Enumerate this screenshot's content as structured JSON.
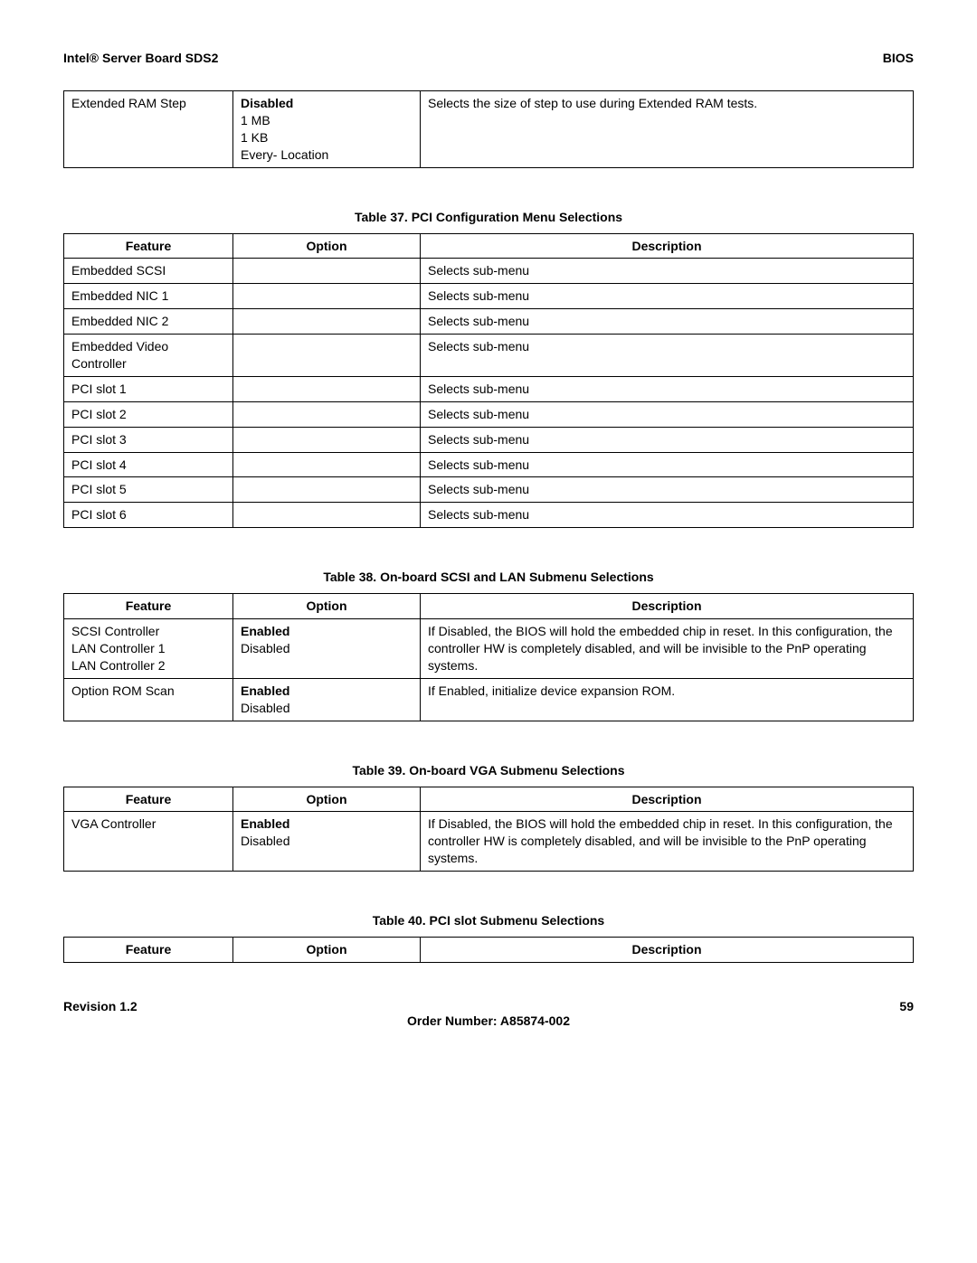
{
  "header": {
    "left": "Intel® Server Board SDS2",
    "right": "BIOS"
  },
  "table36": {
    "rows": [
      {
        "feature": "Extended RAM Step",
        "options": [
          "Disabled",
          "1 MB",
          "1 KB",
          "Every- Location"
        ],
        "default_index": 0,
        "description": "Selects the size of step to use during Extended RAM tests."
      }
    ]
  },
  "table37": {
    "caption": "Table 37. PCI Configuration Menu Selections",
    "headers": {
      "feature": "Feature",
      "option": "Option",
      "description": "Description"
    },
    "rows": [
      {
        "feature": "Embedded SCSI",
        "option": "",
        "description": "Selects sub-menu"
      },
      {
        "feature": "Embedded NIC 1",
        "option": "",
        "description": "Selects sub-menu"
      },
      {
        "feature": "Embedded NIC 2",
        "option": "",
        "description": "Selects sub-menu"
      },
      {
        "feature": "Embedded Video Controller",
        "option": "",
        "description": "Selects sub-menu"
      },
      {
        "feature": "PCI slot 1",
        "option": "",
        "description": "Selects sub-menu"
      },
      {
        "feature": "PCI slot 2",
        "option": "",
        "description": "Selects sub-menu"
      },
      {
        "feature": "PCI slot 3",
        "option": "",
        "description": "Selects sub-menu"
      },
      {
        "feature": "PCI slot 4",
        "option": "",
        "description": "Selects sub-menu"
      },
      {
        "feature": "PCI slot 5",
        "option": "",
        "description": "Selects sub-menu"
      },
      {
        "feature": "PCI slot 6",
        "option": "",
        "description": "Selects sub-menu"
      }
    ]
  },
  "table38": {
    "caption": "Table 38. On-board SCSI and LAN Submenu Selections",
    "headers": {
      "feature": "Feature",
      "option": "Option",
      "description": "Description"
    },
    "rows": [
      {
        "feature_lines": [
          "SCSI Controller",
          "LAN Controller 1",
          "LAN Controller 2"
        ],
        "options": [
          "Enabled",
          "Disabled"
        ],
        "default_index": 0,
        "description": "If Disabled, the BIOS will hold the embedded chip in reset.  In this configuration, the controller HW is completely disabled, and will be invisible to the PnP operating systems."
      },
      {
        "feature_lines": [
          "Option ROM Scan"
        ],
        "options": [
          "Enabled",
          "Disabled"
        ],
        "default_index": 0,
        "description": "If Enabled, initialize device expansion ROM."
      }
    ]
  },
  "table39": {
    "caption": "Table 39. On-board VGA Submenu Selections",
    "headers": {
      "feature": "Feature",
      "option": "Option",
      "description": "Description"
    },
    "rows": [
      {
        "feature": "VGA Controller",
        "options": [
          "Enabled",
          "Disabled"
        ],
        "default_index": 0,
        "description": "If Disabled, the BIOS will hold the embedded chip in reset.  In this configuration, the controller HW is completely disabled, and will be invisible to the PnP operating systems."
      }
    ]
  },
  "table40": {
    "caption": "Table 40. PCI slot Submenu Selections",
    "headers": {
      "feature": "Feature",
      "option": "Option",
      "description": "Description"
    }
  },
  "footer": {
    "left": "Revision 1.2",
    "center": "Order Number:  A85874-002",
    "right": "59"
  }
}
